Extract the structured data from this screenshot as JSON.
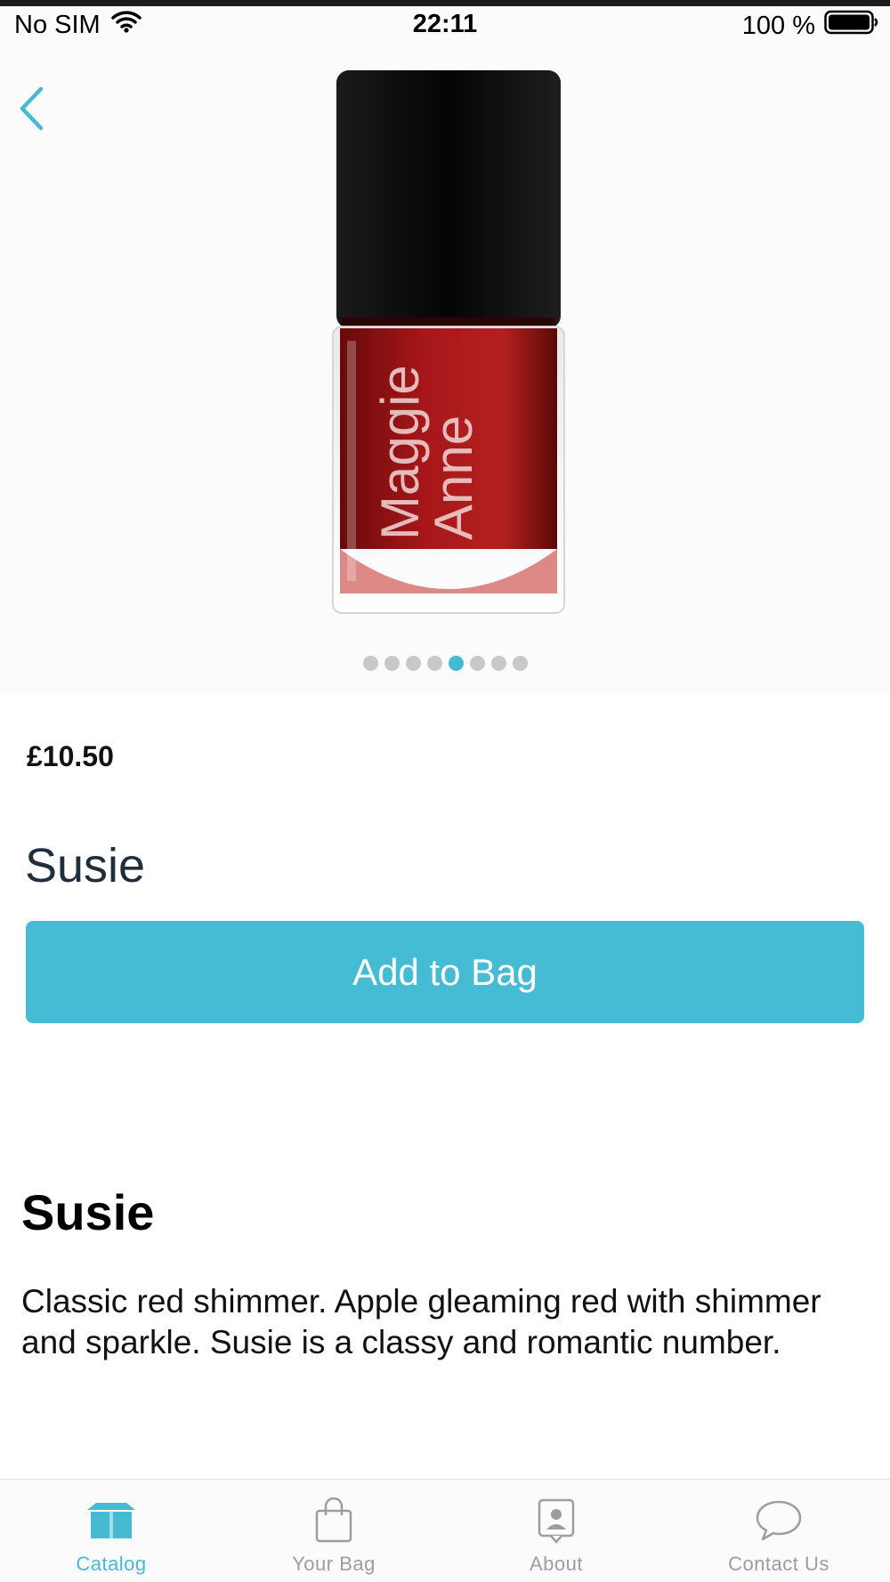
{
  "status_bar": {
    "carrier": "No SIM",
    "time": "22:11",
    "battery": "100 %"
  },
  "product": {
    "image_label_line1": "Maggie",
    "image_label_line2": "Anne",
    "gallery": {
      "count": 8,
      "active_index": 4
    },
    "price": "£10.50",
    "name": "Susie",
    "add_button_label": "Add to Bag",
    "description_title": "Susie",
    "description": "Classic red shimmer. Apple gleaming red with shimmer and sparkle. Susie is a classy and romantic number."
  },
  "tab_bar": {
    "tabs": [
      {
        "label": "Catalog",
        "icon": "box-icon",
        "active": true
      },
      {
        "label": "Your Bag",
        "icon": "bag-icon",
        "active": false
      },
      {
        "label": "About",
        "icon": "person-icon",
        "active": false
      },
      {
        "label": "Contact Us",
        "icon": "chat-icon",
        "active": false
      }
    ]
  },
  "colors": {
    "accent": "#46bcd4",
    "tab_inactive": "#9a9ea3",
    "dot_inactive": "#c8c8c8"
  }
}
